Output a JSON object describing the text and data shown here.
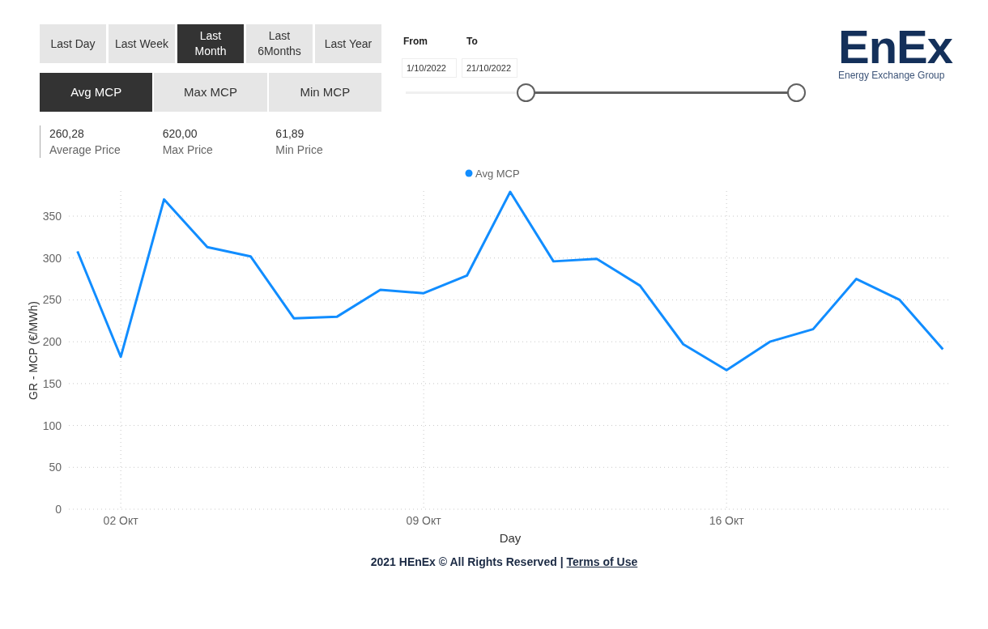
{
  "period_buttons": [
    {
      "label": "Last Day",
      "selected": false
    },
    {
      "label": "Last Week",
      "selected": false
    },
    {
      "label": "Last Month",
      "selected": true
    },
    {
      "label": "Last 6Months",
      "selected": false
    },
    {
      "label": "Last Year",
      "selected": false
    }
  ],
  "measure_buttons": [
    {
      "label": "Avg MCP",
      "selected": true
    },
    {
      "label": "Max MCP",
      "selected": false
    },
    {
      "label": "Min MCP",
      "selected": false
    }
  ],
  "kpis": [
    {
      "value": "260,28",
      "label": "Average Price"
    },
    {
      "value": "620,00",
      "label": "Max Price"
    },
    {
      "value": "61,89",
      "label": "Min Price"
    }
  ],
  "date_range": {
    "from_label": "From",
    "to_label": "To",
    "from": "1/10/2022",
    "to": "21/10/2022",
    "thumbs": [
      {
        "level": 0.3
      },
      {
        "level": 0.98
      }
    ]
  },
  "logo": {
    "name": "EnEx",
    "tagline": "Energy Exchange Group"
  },
  "chart": {
    "chart_data": {
      "type": "line",
      "xlabel": "Day",
      "ylabel": "GR - MCP (€/MWh)",
      "x": [
        1,
        2,
        3,
        4,
        5,
        6,
        7,
        8,
        9,
        10,
        11,
        12,
        13,
        14,
        15,
        16,
        17,
        18,
        19,
        20,
        21
      ],
      "series": [
        {
          "name": "Avg MCP",
          "color": "#118dff",
          "values": [
            308,
            182,
            370,
            313,
            302,
            228,
            230,
            262,
            258,
            279,
            379,
            296,
            299,
            267,
            197,
            166,
            200,
            215,
            275,
            250,
            191
          ]
        }
      ],
      "grid": true,
      "xlim": [
        0.8,
        21.2
      ],
      "ylim": [
        0,
        380
      ],
      "xticks": [
        {
          "value": 2,
          "label": "02 Окт"
        },
        {
          "value": 9,
          "label": "09 Окт"
        },
        {
          "value": 16,
          "label": "16 Окт"
        }
      ],
      "yticks": [
        0,
        50,
        100,
        150,
        200,
        250,
        300,
        350
      ]
    }
  },
  "footer": {
    "text": "2021 HEnEx © All Rights Reserved |",
    "link": "Terms of Use"
  }
}
